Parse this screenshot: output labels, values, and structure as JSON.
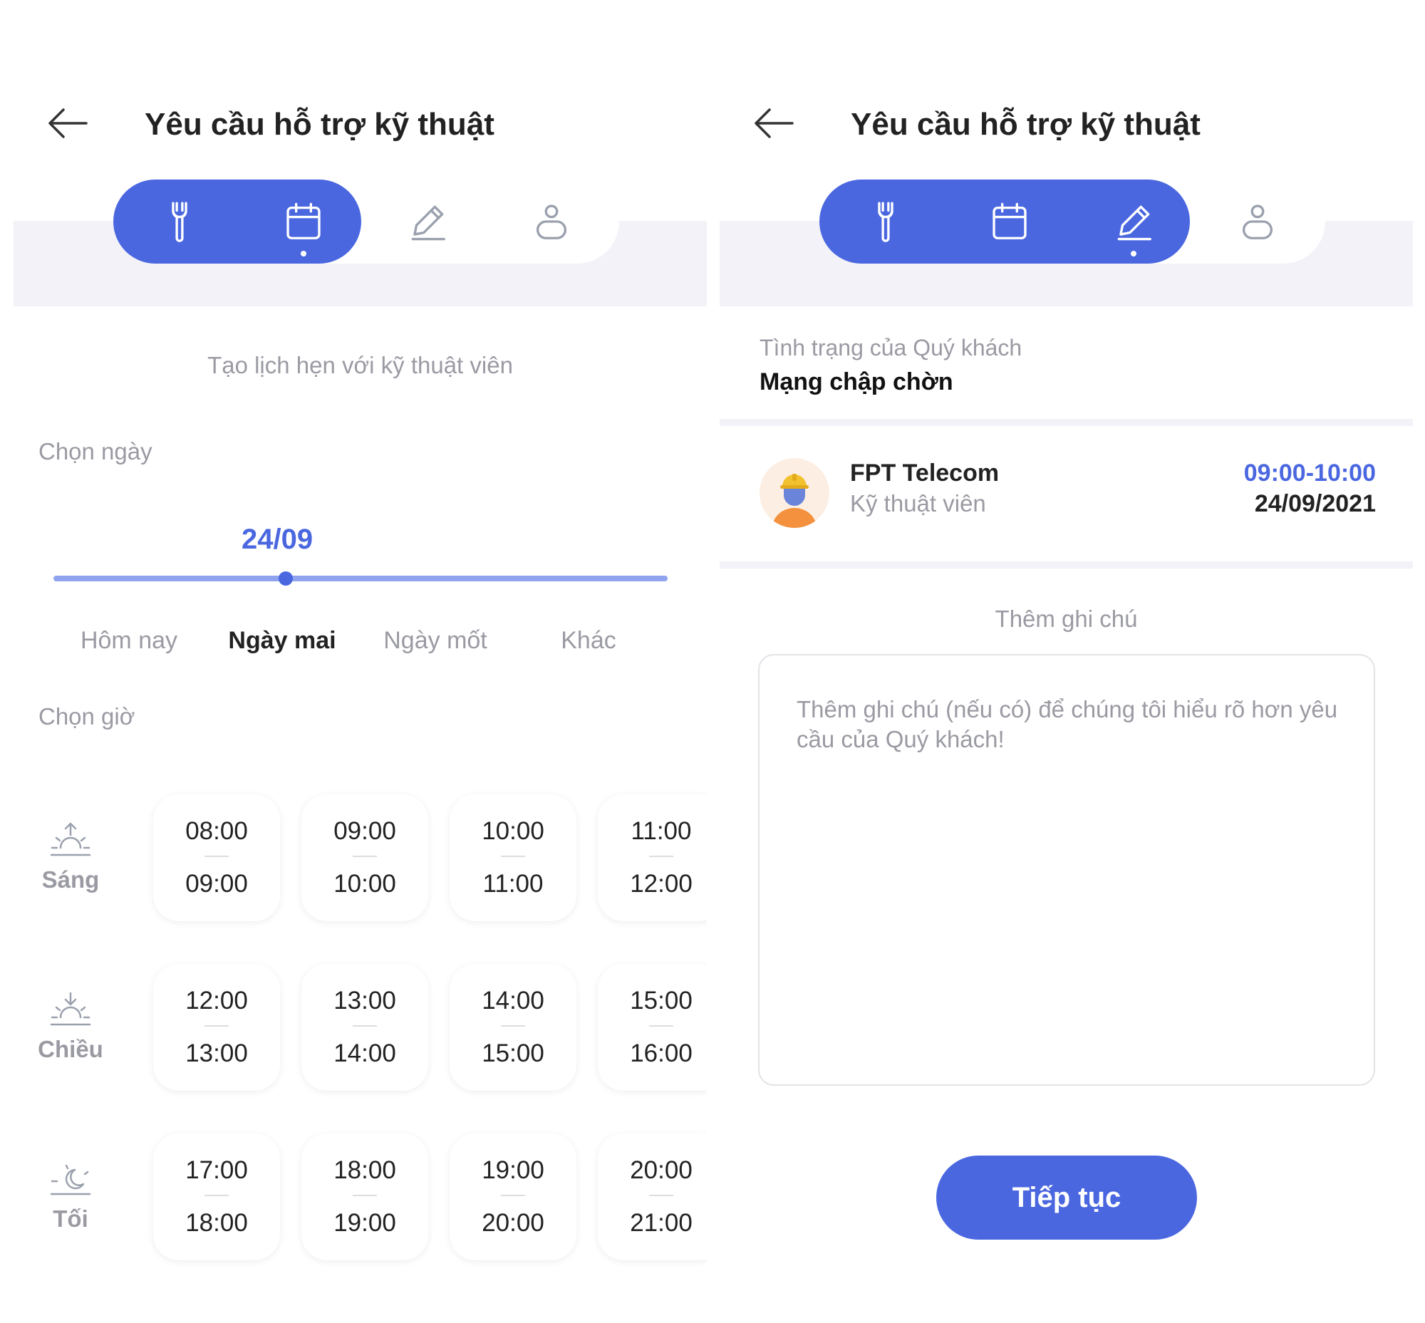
{
  "left": {
    "header": {
      "title": "Yêu cầu hỗ trợ kỹ thuật",
      "back_icon": "arrow-left-icon"
    },
    "stepper": {
      "steps": [
        {
          "icon": "wrench-icon",
          "active": true
        },
        {
          "icon": "calendar-icon",
          "active": true,
          "current": true
        },
        {
          "icon": "pencil-icon",
          "active": false
        },
        {
          "icon": "user-icon",
          "active": false
        }
      ]
    },
    "schedule_title": "Tạo lịch hẹn với kỹ thuật viên",
    "date_section": {
      "label": "Chọn ngày",
      "selected_value": "24/09",
      "options": [
        "Hôm nay",
        "Ngày mai",
        "Ngày mốt",
        "Khác"
      ],
      "selected_option": "Ngày mai"
    },
    "time_section": {
      "label": "Chọn giờ",
      "periods": [
        {
          "name": "Sáng",
          "icon": "sunrise-icon",
          "slots": [
            {
              "start": "08:00",
              "end": "09:00"
            },
            {
              "start": "09:00",
              "end": "10:00"
            },
            {
              "start": "10:00",
              "end": "11:00"
            },
            {
              "start": "11:00",
              "end": "12:00"
            }
          ]
        },
        {
          "name": "Chiều",
          "icon": "sunset-icon",
          "slots": [
            {
              "start": "12:00",
              "end": "13:00"
            },
            {
              "start": "13:00",
              "end": "14:00"
            },
            {
              "start": "14:00",
              "end": "15:00"
            },
            {
              "start": "15:00",
              "end": "16:00"
            }
          ]
        },
        {
          "name": "Tối",
          "icon": "moon-icon",
          "slots": [
            {
              "start": "17:00",
              "end": "18:00"
            },
            {
              "start": "18:00",
              "end": "19:00"
            },
            {
              "start": "19:00",
              "end": "20:00"
            },
            {
              "start": "20:00",
              "end": "21:00"
            }
          ]
        }
      ]
    }
  },
  "right": {
    "header": {
      "title": "Yêu cầu hỗ trợ kỹ thuật",
      "back_icon": "arrow-left-icon"
    },
    "stepper": {
      "steps": [
        {
          "icon": "wrench-icon",
          "active": true
        },
        {
          "icon": "calendar-icon",
          "active": true
        },
        {
          "icon": "pencil-icon",
          "active": true,
          "current": true
        },
        {
          "icon": "user-icon",
          "active": false
        }
      ]
    },
    "status": {
      "label": "Tình trạng của Quý khách",
      "value": "Mạng chập chờn"
    },
    "appointment": {
      "avatar_icon": "technician-avatar-icon",
      "provider": "FPT Telecom",
      "role": "Kỹ thuật viên",
      "time": "09:00-10:00",
      "date": "24/09/2021"
    },
    "note": {
      "title": "Thêm ghi chú",
      "placeholder": "Thêm ghi chú (nếu có) để chúng tôi hiểu rõ hơn yêu cầu của Quý khách!",
      "value": ""
    },
    "continue_label": "Tiếp tục"
  },
  "colors": {
    "accent": "#4a67e0",
    "muted_text": "#9a9aa3",
    "band": "#f2f2f8",
    "text": "#222222"
  }
}
